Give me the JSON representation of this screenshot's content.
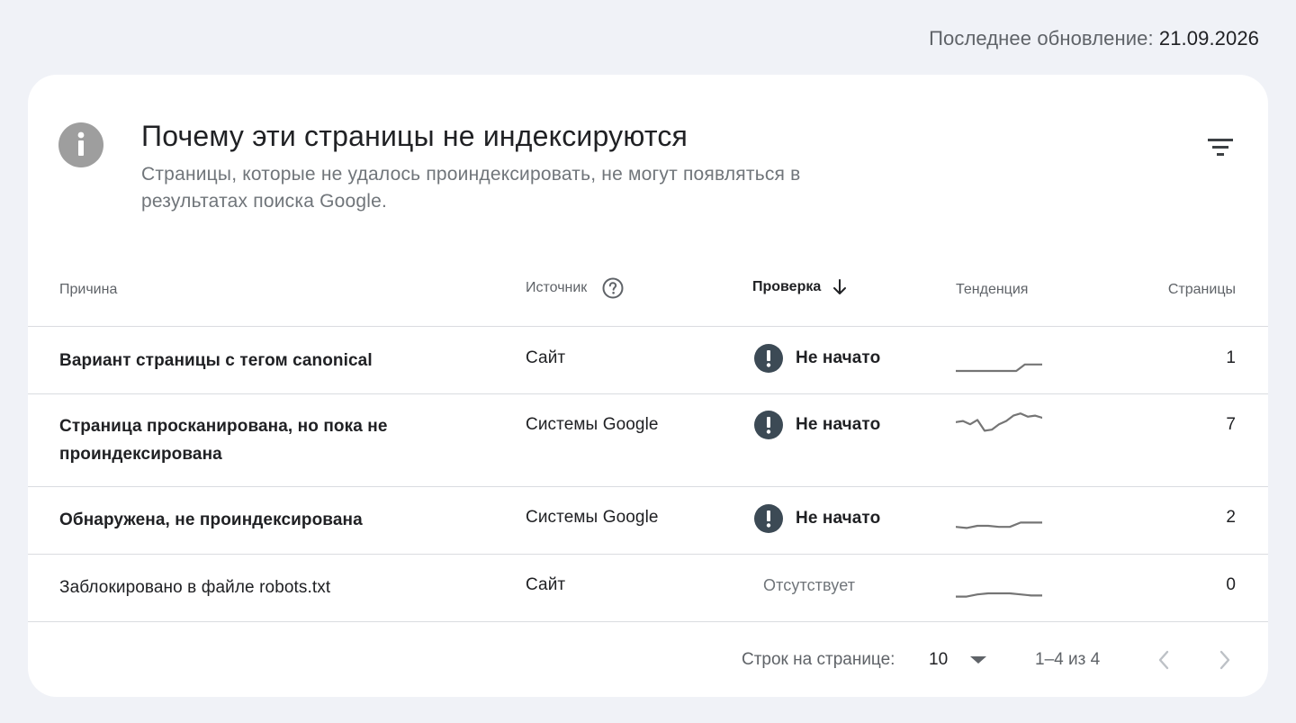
{
  "last_update": {
    "label": "Последнее обновление: ",
    "date": "21.09.2026"
  },
  "card": {
    "title": "Почему эти страницы не индексируются",
    "subtitle": "Страницы, которые не удалось проиндексировать, не могут появляться в результатах поиска Google.",
    "icon": "info-icon",
    "filter_icon": "filter-icon"
  },
  "table": {
    "headers": {
      "reason": "Причина",
      "source": "Источник",
      "check": "Проверка",
      "trend": "Тенденция",
      "pages": "Страницы"
    },
    "rows": [
      {
        "reason": "Вариант страницы с тегом canonical",
        "source": "Сайт",
        "check": "Не начато",
        "pages": "1",
        "trend": [
          0,
          0,
          0,
          0,
          0,
          0,
          0,
          0,
          0.3,
          0.3,
          0.3
        ]
      },
      {
        "reason": "Страница просканирована, но пока не проиндексирована",
        "source": "Системы Google",
        "check": "Не начато",
        "pages": "7",
        "trend": [
          0.55,
          0.6,
          0.45,
          0.65,
          0.15,
          0.2,
          0.45,
          0.6,
          0.85,
          0.95,
          0.8,
          0.85,
          0.75
        ]
      },
      {
        "reason": "Обнаружена, не проиндексирована",
        "source": "Системы Google",
        "check": "Не начато",
        "pages": "2",
        "trend": [
          0.2,
          0.15,
          0.25,
          0.25,
          0.2,
          0.2,
          0.4,
          0.4,
          0.4
        ]
      },
      {
        "reason": "Заблокировано в файле robots.txt",
        "source": "Сайт",
        "check": "Отсутствует",
        "pages": "0",
        "trend": [
          0.1,
          0.1,
          0.2,
          0.25,
          0.25,
          0.25,
          0.2,
          0.15,
          0.15
        ]
      }
    ]
  },
  "footer": {
    "rows_per_page_label": "Строк на странице:",
    "rows_per_page_value": "10",
    "range": "1–4 из 4"
  },
  "colors": {
    "background": "#f0f2f7",
    "card": "#ffffff",
    "icon_gray": "#9e9e9e",
    "alert_dark": "#3c4a55",
    "trend_line": "#757575"
  }
}
